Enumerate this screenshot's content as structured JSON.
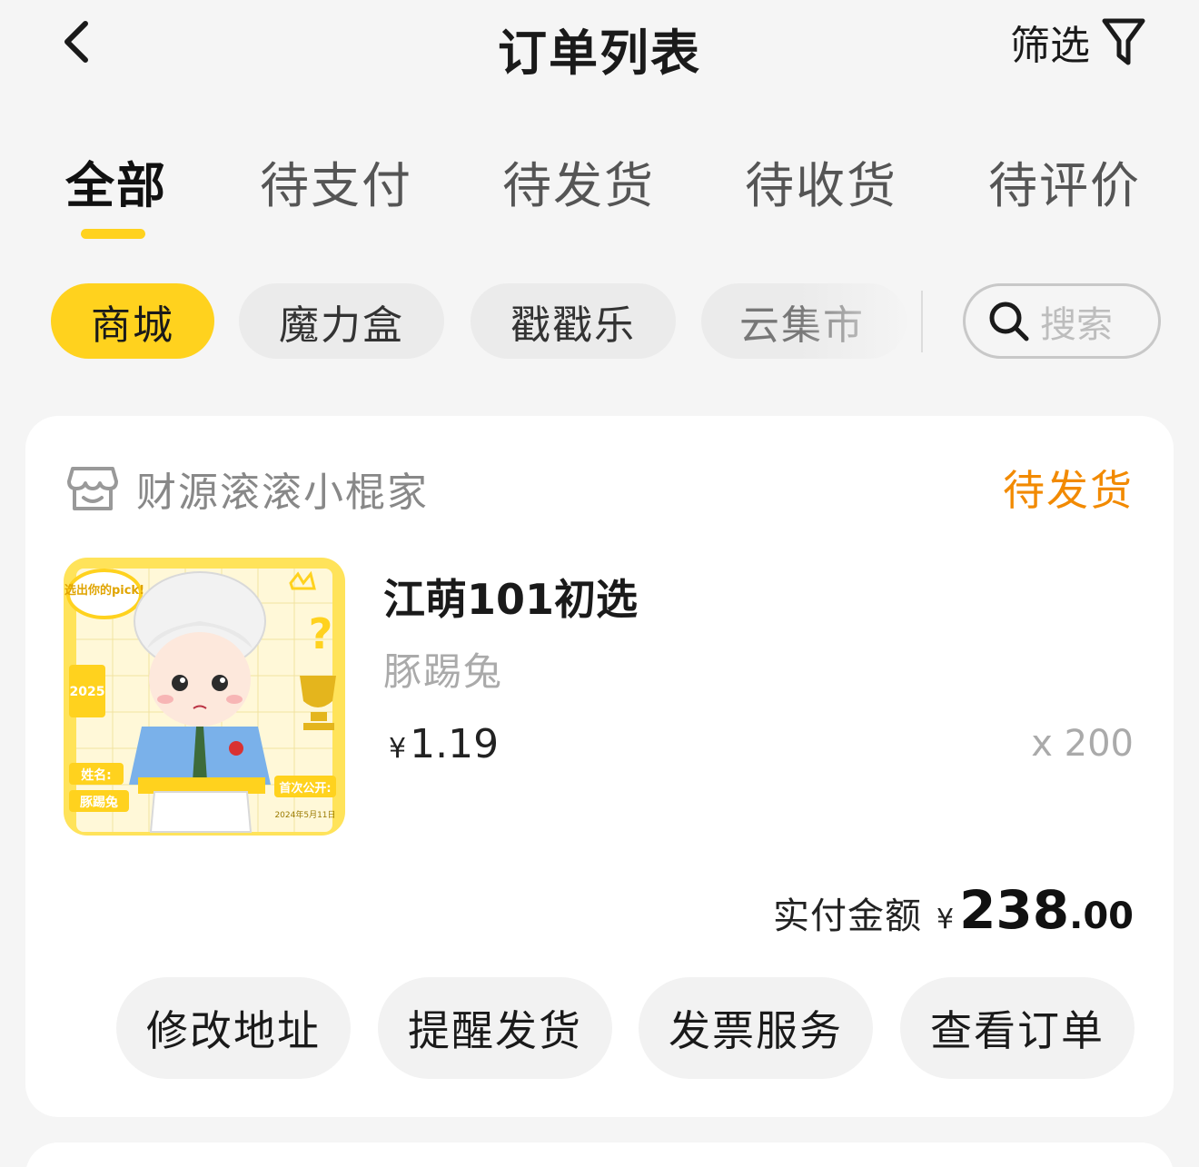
{
  "header": {
    "title": "订单列表",
    "filter_label": "筛选"
  },
  "tabs": [
    {
      "label": "全部",
      "active": true
    },
    {
      "label": "待支付",
      "active": false
    },
    {
      "label": "待发货",
      "active": false
    },
    {
      "label": "待收货",
      "active": false
    },
    {
      "label": "待评价",
      "active": false
    }
  ],
  "categories": [
    {
      "label": "商城",
      "active": true
    },
    {
      "label": "魔力盒",
      "active": false
    },
    {
      "label": "戳戳乐",
      "active": false
    },
    {
      "label": "云集市",
      "active": false
    }
  ],
  "search": {
    "placeholder": "搜索"
  },
  "order": {
    "shop_name": "财源滚滚小棍家",
    "status": "待发货",
    "product_name": "江萌101初选",
    "variant": "豚踢兔",
    "price_symbol": "¥",
    "price": "1.19",
    "quantity": "x 200",
    "paid_label": "实付金额",
    "paid_symbol": "¥",
    "paid_int": "238",
    "paid_dec": ".00",
    "image_text": {
      "badge": "选出你的pick!",
      "year": "2025",
      "name_label": "姓名:",
      "name_value": "豚踢兔",
      "debut_label": "首次公开:",
      "debut_date": "2024年5月11日"
    },
    "actions": [
      "修改地址",
      "提醒发货",
      "发票服务",
      "查看订单"
    ]
  },
  "colors": {
    "accent": "#ffd21e",
    "status": "#f28a00",
    "background": "#f5f5f5"
  }
}
